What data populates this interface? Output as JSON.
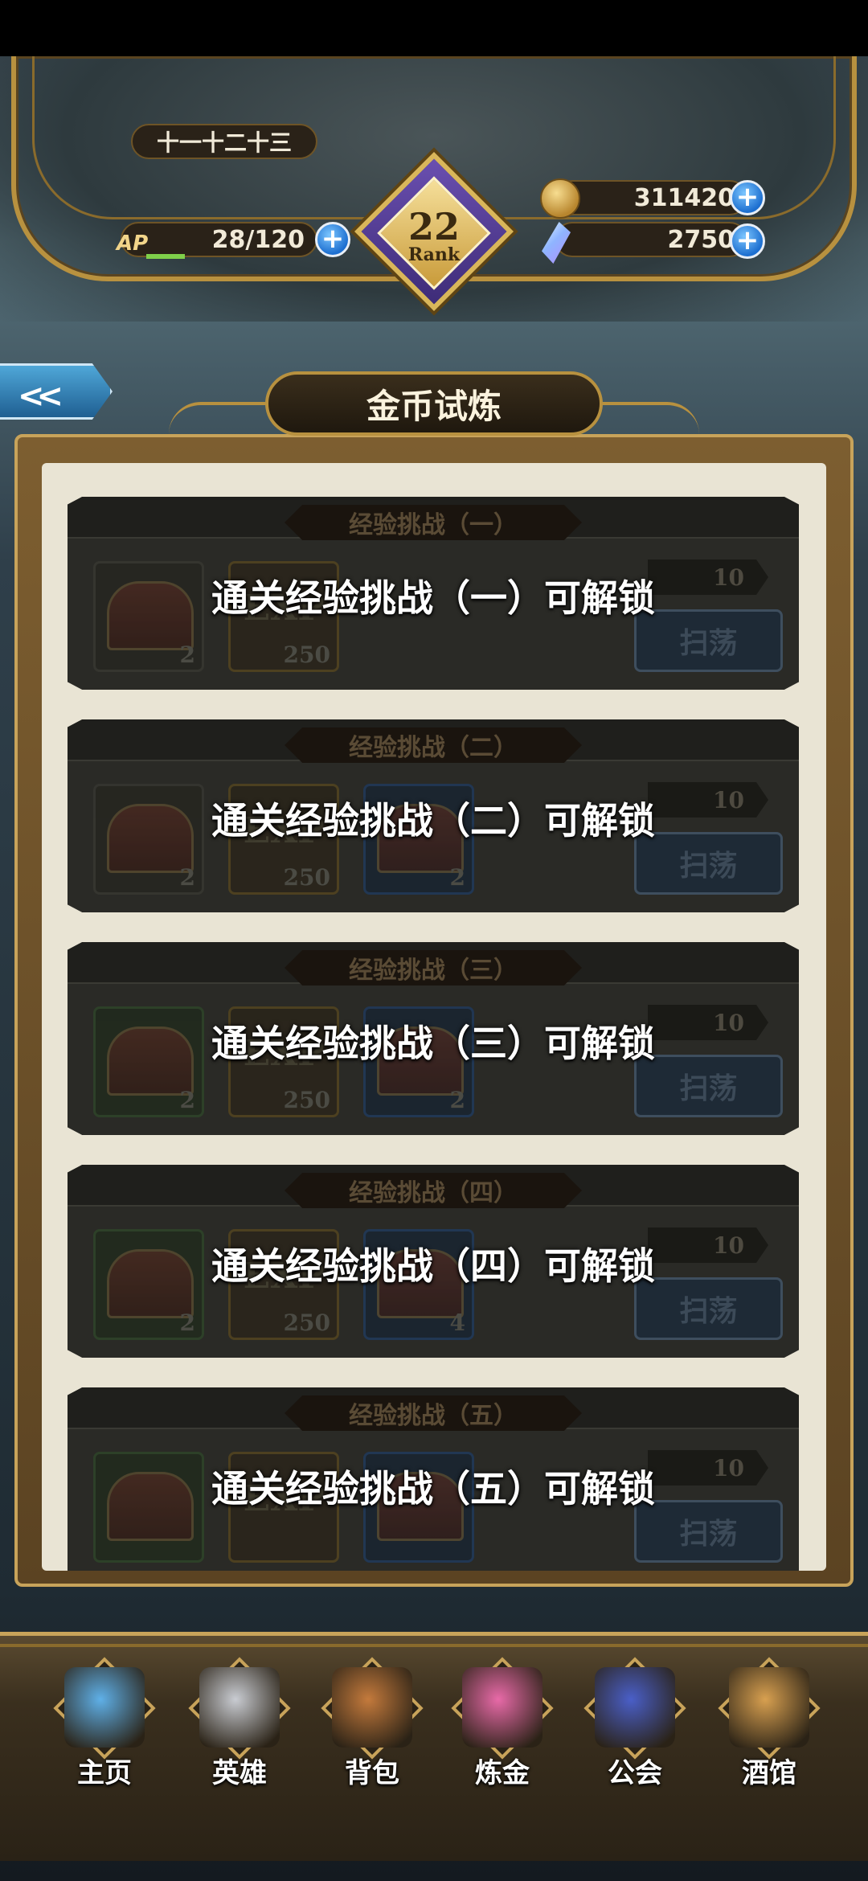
{
  "hud": {
    "player_name": "十一十二十三",
    "ap_label": "AP",
    "ap_value": "28/120",
    "gold_value": "311420",
    "gem_value": "2750",
    "rank_number": "22",
    "rank_label": "Rank",
    "plus_symbol": "+"
  },
  "header": {
    "back_icon": "back-arrow-icon",
    "back_glyph": "<<",
    "title": "金币试炼"
  },
  "challenges": [
    {
      "ribbon": "经验挑战（一）",
      "lock_text": "通关经验挑战（一）可解锁",
      "rewards": [
        {
          "type": "chest",
          "count": "2"
        },
        {
          "type": "exp",
          "glyph": "EXP",
          "count": "250"
        }
      ],
      "cost": "10",
      "sweep_label": "扫荡"
    },
    {
      "ribbon": "经验挑战（二）",
      "lock_text": "通关经验挑战（二）可解锁",
      "rewards": [
        {
          "type": "chest",
          "count": "2"
        },
        {
          "type": "exp",
          "glyph": "EXP",
          "count": "250"
        },
        {
          "type": "chest",
          "count": "2"
        }
      ],
      "cost": "10",
      "sweep_label": "扫荡"
    },
    {
      "ribbon": "经验挑战（三）",
      "lock_text": "通关经验挑战（三）可解锁",
      "rewards": [
        {
          "type": "chest",
          "count": "2"
        },
        {
          "type": "exp",
          "glyph": "EXP",
          "count": "250"
        },
        {
          "type": "chest",
          "count": "2"
        }
      ],
      "cost": "10",
      "sweep_label": "扫荡"
    },
    {
      "ribbon": "经验挑战（四）",
      "lock_text": "通关经验挑战（四）可解锁",
      "rewards": [
        {
          "type": "chest",
          "count": "2"
        },
        {
          "type": "exp",
          "glyph": "EXP",
          "count": "250"
        },
        {
          "type": "chest",
          "count": "4"
        }
      ],
      "cost": "10",
      "sweep_label": "扫荡"
    },
    {
      "ribbon": "经验挑战（五）",
      "lock_text": "通关经验挑战（五）可解锁",
      "rewards": [
        {
          "type": "chest",
          "count": ""
        },
        {
          "type": "exp",
          "glyph": "EXP",
          "count": ""
        },
        {
          "type": "chest",
          "count": ""
        }
      ],
      "cost": "10",
      "sweep_label": "扫荡"
    }
  ],
  "nav": [
    {
      "label": "主页",
      "icon": "castle-icon",
      "color": "#5fb0e8"
    },
    {
      "label": "英雄",
      "icon": "helmet-icon",
      "color": "#c9ccd2"
    },
    {
      "label": "背包",
      "icon": "backpack-icon",
      "color": "#c47a3c"
    },
    {
      "label": "炼金",
      "icon": "potion-icon",
      "color": "#e86aa8"
    },
    {
      "label": "公会",
      "icon": "guild-shield-icon",
      "color": "#4a5fc8"
    },
    {
      "label": "酒馆",
      "icon": "beer-mug-icon",
      "color": "#d8a050"
    }
  ]
}
